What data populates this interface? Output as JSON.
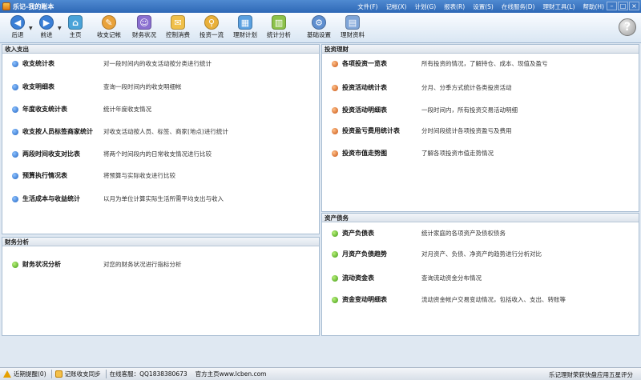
{
  "window": {
    "title": "乐记-我的账本",
    "menu": [
      "文件(F)",
      "记帐(X)",
      "计划(G)",
      "报表(R)",
      "设置(S)",
      "在线服务(D)",
      "理财工具(L)",
      "帮助(H)"
    ],
    "controls": [
      "–",
      "□",
      "×"
    ]
  },
  "toolbar": {
    "items": [
      {
        "label": "后退",
        "icon": "back-arrow-icon",
        "glyph": "◀",
        "color": "#3a7fd6"
      },
      {
        "label": "前进",
        "icon": "forward-arrow-icon",
        "glyph": "▶",
        "color": "#3a7fd6"
      },
      {
        "label": "主页",
        "icon": "home-icon",
        "glyph": "⌂",
        "color": "#4aa3d8"
      },
      {
        "label": "收支记帐",
        "icon": "pencil-icon",
        "glyph": "✎",
        "color": "#e9a23a"
      },
      {
        "label": "财务状况",
        "icon": "person-icon",
        "glyph": "☺",
        "color": "#8a6fd0"
      },
      {
        "label": "控制消费",
        "icon": "envelope-icon",
        "glyph": "✉",
        "color": "#f0c04a"
      },
      {
        "label": "投资一流",
        "icon": "magnifier-icon",
        "glyph": "⚲",
        "color": "#e9b03a"
      },
      {
        "label": "理财计划",
        "icon": "calendar-icon",
        "glyph": "▦",
        "color": "#5aa0e0"
      },
      {
        "label": "统计分析",
        "icon": "bar-chart-icon",
        "glyph": "▥",
        "color": "#8cc24a"
      },
      {
        "label": "基础设置",
        "icon": "gear-icon",
        "glyph": "⚙",
        "color": "#5f8fd0"
      },
      {
        "label": "理财资料",
        "icon": "document-icon",
        "glyph": "▤",
        "color": "#7fa5d8"
      }
    ],
    "help": "?"
  },
  "income_panel": {
    "title": "收入支出",
    "rows": [
      {
        "name": "收支统计表",
        "desc": "对一段时间内的收支活动按分类进行统计"
      },
      {
        "name": "收支明细表",
        "desc": "查询一段时间内的收支明细帐"
      },
      {
        "name": "年度收支统计表",
        "desc": "统计年度收支情况"
      },
      {
        "name": "收支按人员标签商家统计",
        "desc": "对收支活动按人员、标签、商家(地点)进行统计"
      },
      {
        "name": "两段时间收支对比表",
        "desc": "将两个时间段内的日常收支情况进行比较"
      },
      {
        "name": "预算执行情况表",
        "desc": "将预算与实际收支进行比较"
      },
      {
        "name": "生活成本与收益统计",
        "desc": "以月为单位计算实际生活所需平均支出与收入"
      }
    ]
  },
  "finance_panel": {
    "title": "财务分析",
    "rows": [
      {
        "name": "财务状况分析",
        "desc": "对您的财务状况进行指标分析"
      }
    ]
  },
  "invest_panel": {
    "title": "投资理财",
    "rows": [
      {
        "name": "各项投资一览表",
        "desc": "所有投资的情况，了解持仓、成本、现值及盈亏"
      },
      {
        "name": "投资活动统计表",
        "desc": "分月、分季方式统计各类投资活动"
      },
      {
        "name": "投资活动明细表",
        "desc": "一段时间内，所有投资交易活动明细"
      },
      {
        "name": "投资盈亏费用统计表",
        "desc": "分时间段统计各项投资盈亏及费用"
      },
      {
        "name": "投资市值走势图",
        "desc": "了解各项投资市值走势情况"
      }
    ]
  },
  "assets_panel": {
    "title": "资产债务",
    "rows": [
      {
        "name": "资产负债表",
        "desc": "统计家庭的各项资产及债权债务"
      },
      {
        "name": "月资产负债趋势",
        "desc": "对月资产、负债、净资产的趋势进行分析对比"
      },
      {
        "name": "流动资金表",
        "desc": "查询流动资金分布情况"
      },
      {
        "name": "资金变动明细表",
        "desc": "流动资金帐户交易变动情况，包括收入、支出、转账等"
      }
    ]
  },
  "statusbar": {
    "reminder": "近期提醒(0)",
    "sync": "记账收支同步",
    "service": "在线客服：QQ1838380673",
    "website": "官方主页www.lcben.com",
    "rating": "乐记理财荣获快盘应用五星评分"
  }
}
